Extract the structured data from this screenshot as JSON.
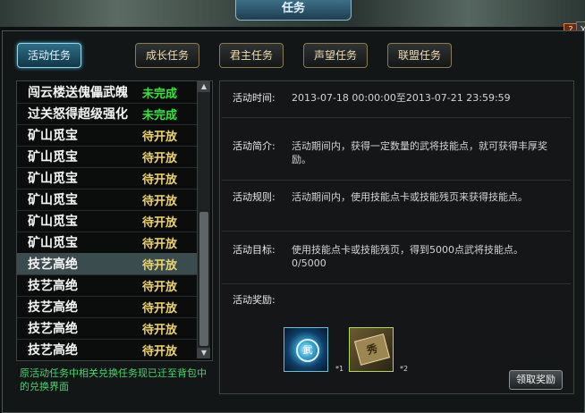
{
  "window": {
    "title": "任务",
    "help_label": "?",
    "close_label": "X"
  },
  "tabs": [
    {
      "label": "活动任务",
      "active": true
    },
    {
      "label": "成长任务",
      "active": false
    },
    {
      "label": "君主任务",
      "active": false
    },
    {
      "label": "声望任务",
      "active": false
    },
    {
      "label": "联盟任务",
      "active": false
    }
  ],
  "task_list": [
    {
      "name": "闯云楼送傀儡武魄",
      "status": "未完成",
      "state": "done"
    },
    {
      "name": "过关怒得超级强化",
      "status": "未完成",
      "state": "done"
    },
    {
      "name": "矿山觅宝",
      "status": "待开放",
      "state": "wait"
    },
    {
      "name": "矿山觅宝",
      "status": "待开放",
      "state": "wait"
    },
    {
      "name": "矿山觅宝",
      "status": "待开放",
      "state": "wait"
    },
    {
      "name": "矿山觅宝",
      "status": "待开放",
      "state": "wait"
    },
    {
      "name": "矿山觅宝",
      "status": "待开放",
      "state": "wait"
    },
    {
      "name": "矿山觅宝",
      "status": "待开放",
      "state": "wait"
    },
    {
      "name": "技艺高绝",
      "status": "待开放",
      "state": "wait",
      "selected": true
    },
    {
      "name": "技艺高绝",
      "status": "待开放",
      "state": "wait"
    },
    {
      "name": "技艺高绝",
      "status": "待开放",
      "state": "wait"
    },
    {
      "name": "技艺高绝",
      "status": "待开放",
      "state": "wait"
    },
    {
      "name": "技艺高绝",
      "status": "待开放",
      "state": "wait"
    }
  ],
  "scrollbar": {
    "up": "▲",
    "down": "▼"
  },
  "notice": "原活动任务中相关兑换任务现已迁至背包中的兑换界面",
  "detail": {
    "time_label": "活动时间:",
    "time_value": "2013-07-18 00:00:00至2013-07-21 23:59:59",
    "intro_label": "活动简介:",
    "intro_value": "活动期间内，获得一定数量的武将技能点，就可获得丰厚奖励。",
    "rule_label": "活动规则:",
    "rule_value": "活动期间内，使用技能点卡或技能残页来获得技能点。",
    "goal_label": "活动目标:",
    "goal_value": "使用技能点卡或技能残页，得到5000点武将技能点。",
    "progress": "0/5000",
    "reward_label": "活动奖励:"
  },
  "rewards": [
    {
      "icon": "skill-orb-icon",
      "glyph": "武",
      "count": "*1"
    },
    {
      "icon": "skill-page-icon",
      "glyph": "秀",
      "count": "*2"
    }
  ],
  "claim_button": "领取奖励"
}
